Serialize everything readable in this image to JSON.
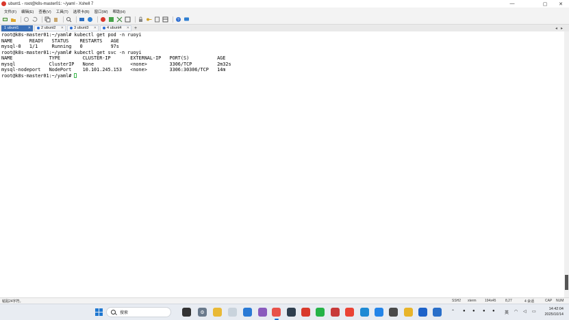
{
  "window": {
    "title": "ubunt1 - root@k8s-master01: ~/yaml - Xshell 7",
    "controls": [
      "—",
      "▢",
      "✕"
    ]
  },
  "menu": [
    "文件(F)",
    "编辑(E)",
    "查看(V)",
    "工具(T)",
    "选项卡(B)",
    "窗口(W)",
    "帮助(H)"
  ],
  "tabs": [
    {
      "label": "1 ubunt1",
      "active": true
    },
    {
      "label": "2 ubunt2",
      "active": false
    },
    {
      "label": "3 ubunt3",
      "active": false
    },
    {
      "label": "4 ubunt4",
      "active": false
    }
  ],
  "tab_add": "+",
  "terminal": {
    "lines": [
      "root@k8s-master01:~/yaml# kubectl get pod -n ruoyi",
      "NAME      READY   STATUS    RESTARTS   AGE",
      "mysql-0   1/1     Running   0          97s",
      "root@k8s-master01:~/yaml# kubectl get svc -n ruoyi",
      "NAME             TYPE        CLUSTER-IP       EXTERNAL-IP   PORT(S)          AGE",
      "mysql            ClusterIP   None             <none>        3306/TCP         2m32s",
      "mysql-nodeport   NodePort    10.101.245.153   <none>        3306:30306/TCP   14m"
    ],
    "prompt": "root@k8s-master01:~/yaml# "
  },
  "status": {
    "left": "粘贴24字符。",
    "protocol": "SSH2",
    "term": "xterm",
    "size": "194x45",
    "pos": "8,27",
    "sessions": "4 会话",
    "caps": "CAP",
    "num": "NUM"
  },
  "taskbar": {
    "search_placeholder": "搜索",
    "tray_lang": "英",
    "time": "14:42:04",
    "date": "2025/10/14"
  },
  "colors": {
    "tab_active": "#3b6fb6",
    "cursor": "#39b54a",
    "app_icon": "#d9372b"
  }
}
